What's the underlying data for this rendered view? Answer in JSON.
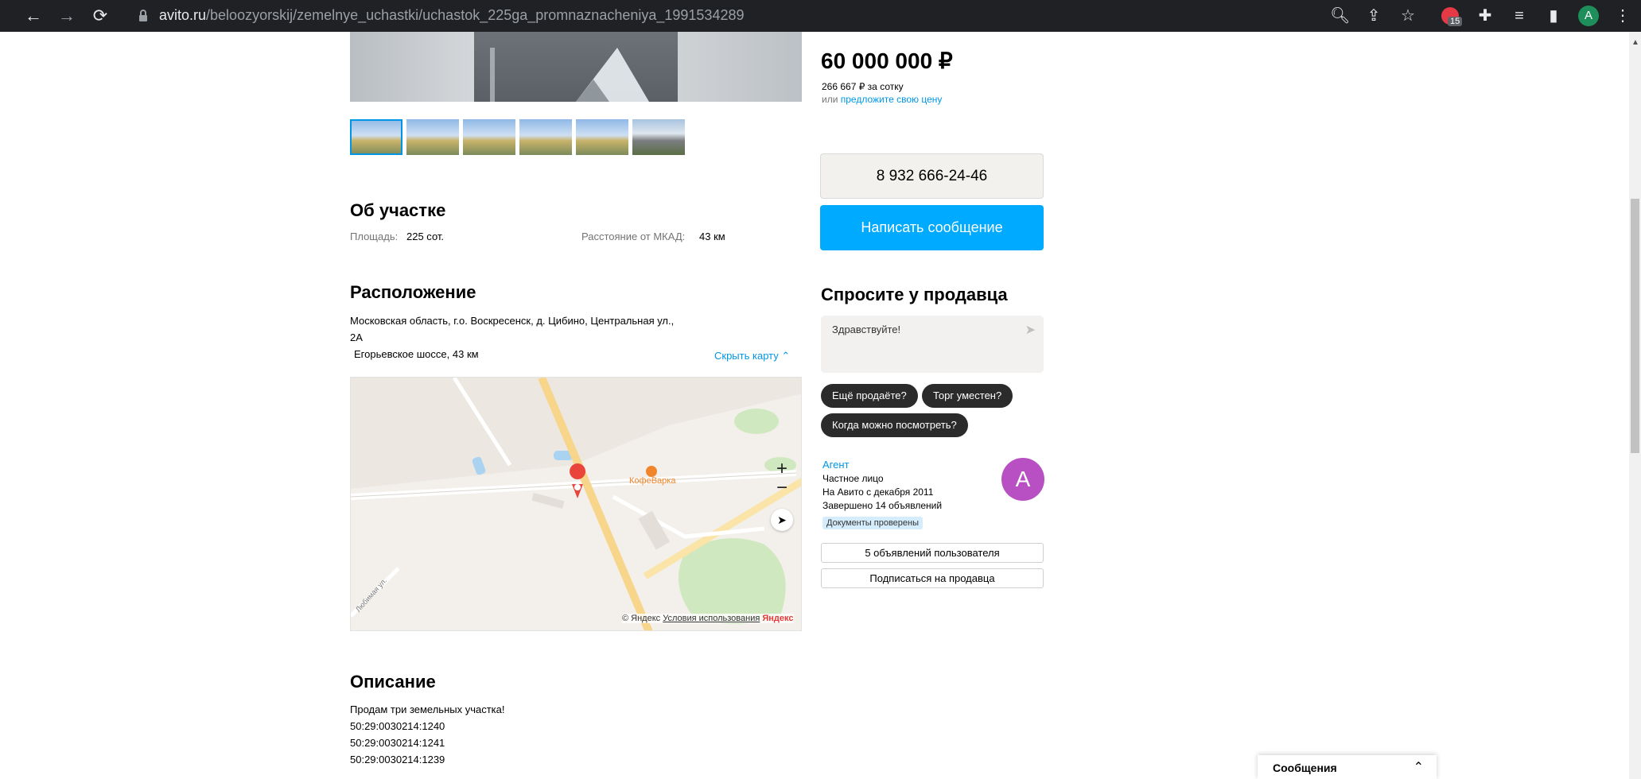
{
  "browser": {
    "url_domain": "avito.ru",
    "url_path": "/beloozyorskij/zemelnye_uchastki/uchastok_225ga_promnaznacheniya_1991534289",
    "extension_badge": "15",
    "profile_initial": "A"
  },
  "listing": {
    "price": "60 000 000 ₽",
    "price_per_unit": "266 667 ₽ за сотку",
    "offer_prefix": "или ",
    "offer_link": "предложите свою цену"
  },
  "about": {
    "title": "Об участке",
    "area_label": "Площадь:",
    "area_value": "225 сот.",
    "distance_label": "Расстояние от МКАД:",
    "distance_value": "43 км"
  },
  "location": {
    "title": "Расположение",
    "address_line1": "Московская область, г.о. Воскресенск, д. Цибино, Центральная ул.,",
    "address_line2": "2А",
    "highway": "Егорьевское шоссе, 43 км",
    "hide_map": "Скрыть карту"
  },
  "map": {
    "poi_label": "КофеВарка",
    "copyright": "© Яндекс",
    "terms": "Условия использования",
    "brand": "Яндекс",
    "zoom_in": "+",
    "zoom_out": "−",
    "street_label": "Любимая ул."
  },
  "contact": {
    "phone": "8 932 666-24-46",
    "write_message": "Написать сообщение"
  },
  "ask": {
    "title": "Спросите у продавца",
    "placeholder": "Здравствуйте!",
    "chips": [
      "Ещё продаёте?",
      "Торг уместен?",
      "Когда можно посмотреть?"
    ]
  },
  "seller": {
    "name": "Агент",
    "type": "Частное лицо",
    "since": "На Авито с декабря 2011",
    "completed": "Завершено 14 объявлений",
    "badge": "Документы проверены",
    "avatar_letter": "A",
    "listings_button": "5 объявлений пользователя",
    "subscribe_button": "Подписаться на продавца"
  },
  "description": {
    "title": "Описание",
    "lines": [
      "Продам три земельных участка!",
      "50:29:0030214:1240",
      "50:29:0030214:1241",
      "50:29:0030214:1239"
    ]
  },
  "messages_panel": {
    "label": "Сообщения"
  }
}
